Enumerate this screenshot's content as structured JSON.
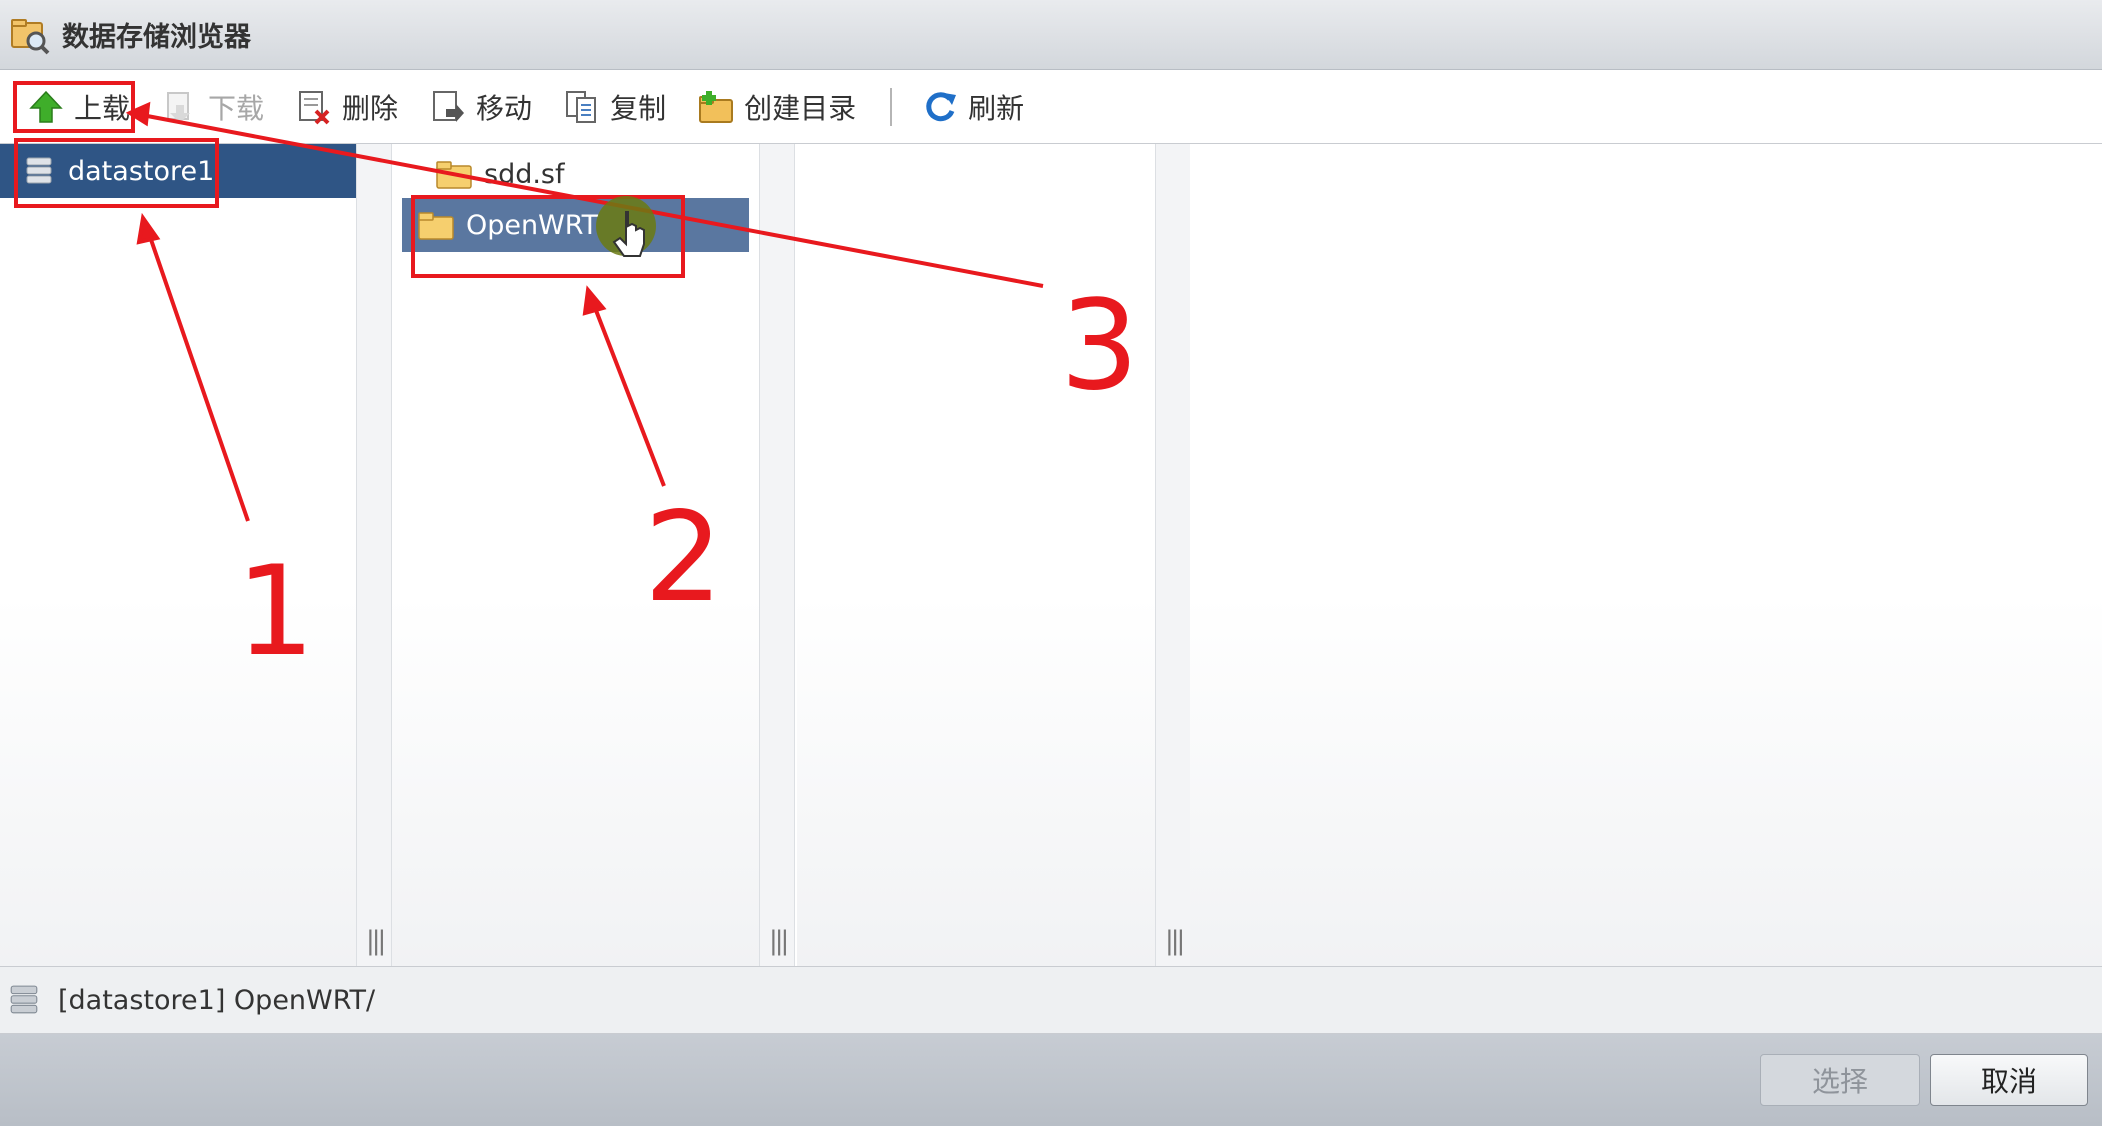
{
  "window": {
    "title": "数据存储浏览器",
    "title_icon": "datastore-browser-icon"
  },
  "toolbar": {
    "buttons": [
      {
        "label": "上载",
        "icon": "upload-arrow-icon",
        "enabled": true
      },
      {
        "label": "下载",
        "icon": "download-icon",
        "enabled": false
      },
      {
        "label": "删除",
        "icon": "delete-icon",
        "enabled": true
      },
      {
        "label": "移动",
        "icon": "move-icon",
        "enabled": true
      },
      {
        "label": "复制",
        "icon": "copy-icon",
        "enabled": true
      },
      {
        "label": "创建目录",
        "icon": "create-folder-icon",
        "enabled": true
      },
      {
        "label": "刷新",
        "icon": "refresh-icon",
        "enabled": true
      }
    ]
  },
  "datastores": [
    {
      "name": "datastore1",
      "selected": true
    }
  ],
  "folders": [
    {
      "name": "sdd.sf",
      "selected": false
    },
    {
      "name": "OpenWRT",
      "selected": true
    }
  ],
  "splitter_grip": "|||",
  "status": {
    "path": "[datastore1] OpenWRT/"
  },
  "footer": {
    "select_label": "选择",
    "cancel_label": "取消"
  },
  "annotations": {
    "labels": [
      "1",
      "2",
      "3"
    ],
    "color": "#e8191e"
  },
  "colors": {
    "selection": "#2f5585",
    "selection_secondary": "#5a77a0",
    "annotation": "#e8191e"
  }
}
